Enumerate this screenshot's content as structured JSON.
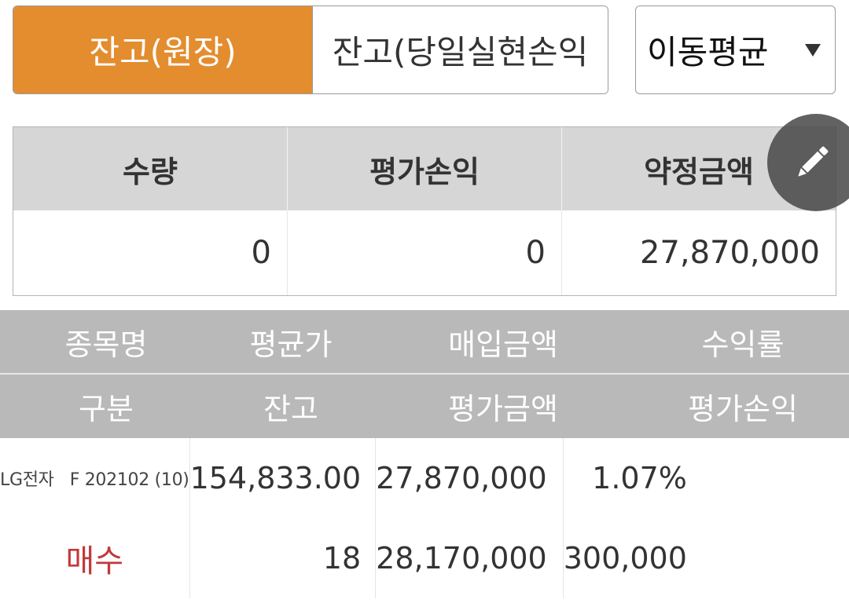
{
  "tabs": {
    "active_label": "잔고(원장)",
    "inactive_label": "잔고(당일실현손익"
  },
  "average_select": {
    "value": "이동평균"
  },
  "summary": {
    "headers": [
      "수량",
      "평가손익",
      "약정금액"
    ],
    "values": [
      "0",
      "0",
      "27,870,000"
    ]
  },
  "holdings": {
    "header_row1": [
      "종목명",
      "평균가",
      "매입금액",
      "수익률"
    ],
    "header_row2": [
      "구분",
      "잔고",
      "평가금액",
      "평가손익"
    ],
    "items": [
      {
        "name": "LG전자",
        "code": "F 202102 (10)",
        "avg_price": "154,833.00",
        "purchase_amount": "27,870,000",
        "return_rate": "1.07%",
        "side": "매수",
        "balance": "18",
        "eval_amount": "28,170,000",
        "eval_pl": "300,000"
      }
    ]
  },
  "colors": {
    "accent": "#e38d2f",
    "profit": "#c0393b",
    "header_gray": "#b9b9b9",
    "summary_header": "#d6d6d6"
  },
  "icons": {
    "edit": "pencil-icon",
    "dropdown": "chevron-down-icon"
  }
}
